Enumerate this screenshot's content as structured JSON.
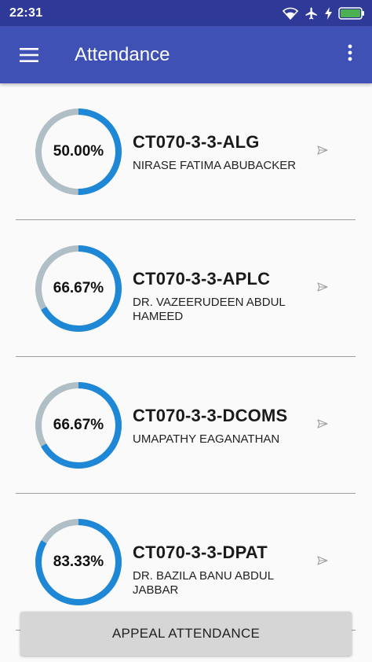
{
  "status_bar": {
    "time": "22:31",
    "icons": [
      "wifi-icon",
      "airplane-mode-icon",
      "charging-icon",
      "battery-icon"
    ]
  },
  "app_bar": {
    "title": "Attendance",
    "menu_icon": "hamburger-menu-icon",
    "overflow_icon": "more-vert-icon"
  },
  "colors": {
    "app_bar": "#3f51b5",
    "status_bar": "#2f3a98",
    "ring_track": "#b0bec5",
    "ring_progress": "#1e88d6"
  },
  "courses": [
    {
      "percent_label": "50.00%",
      "percent_value": 50.0,
      "code": "CT070-3-3-ALG",
      "lecturer_lines": [
        "NIRASE FATIMA ABUBACKER"
      ]
    },
    {
      "percent_label": "66.67%",
      "percent_value": 66.67,
      "code": "CT070-3-3-APLC",
      "lecturer_lines": [
        "DR. VAZEERUDEEN ABDUL",
        "HAMEED"
      ]
    },
    {
      "percent_label": "66.67%",
      "percent_value": 66.67,
      "code": "CT070-3-3-DCOMS",
      "lecturer_lines": [
        "UMAPATHY EAGANATHAN"
      ]
    },
    {
      "percent_label": "83.33%",
      "percent_value": 83.33,
      "code": "CT070-3-3-DPAT",
      "lecturer_lines": [
        "DR. BAZILA BANU ABDUL",
        "JABBAR"
      ]
    }
  ],
  "appeal_button": {
    "label": "APPEAL ATTENDANCE"
  }
}
